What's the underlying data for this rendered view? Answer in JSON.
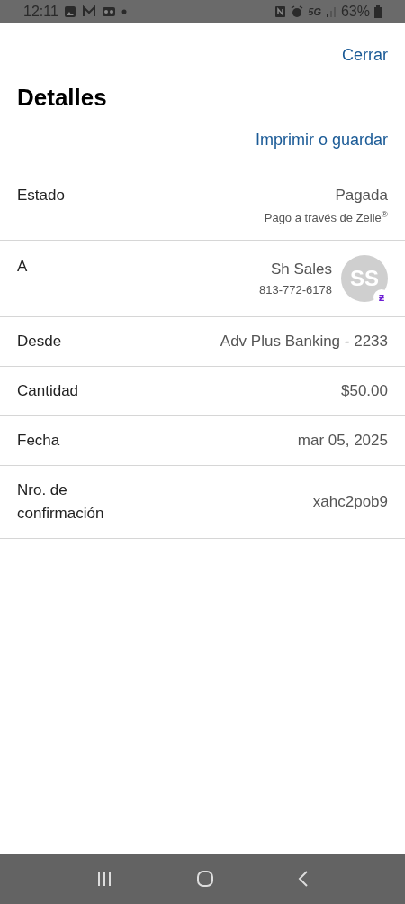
{
  "status_bar": {
    "time": "12:11",
    "battery": "63%",
    "network": "5G"
  },
  "header": {
    "close": "Cerrar",
    "title": "Detalles",
    "print": "Imprimir o guardar"
  },
  "rows": [
    {
      "kind": "status",
      "label": "Estado",
      "value": "Pagada",
      "note": "Pago a través de Zelle$^{®}$"
    },
    {
      "kind": "payee",
      "label": "A",
      "value": "Sh Sales",
      "note": "813-772-6178",
      "initials": "SS",
      "badge": "ƶ"
    },
    {
      "kind": "simple",
      "label": "Desde",
      "value": "Adv Plus Banking - 2233"
    },
    {
      "kind": "simple",
      "label": "Cantidad",
      "value": "$50.00"
    },
    {
      "kind": "simple",
      "label": "Fecha",
      "value": "mar 05, 2025"
    },
    {
      "kind": "simple",
      "label": "Nro. de confirmación",
      "value": "xahc2pob9"
    }
  ]
}
